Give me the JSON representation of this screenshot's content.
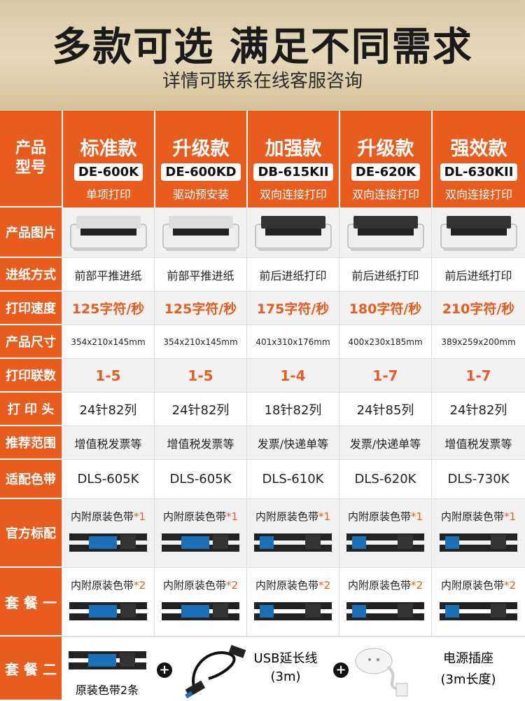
{
  "hero": {
    "title": "多款可选 满足不同需求",
    "subtitle": "详情可联系在线客服咨询"
  },
  "labels": {
    "model": "产品\n型号",
    "image": "产品图片",
    "feed": "进纸方式",
    "speed": "打印速度",
    "size": "产品尺寸",
    "copies": "打印联数",
    "head": "打 印 头",
    "usage": "推荐范围",
    "ribbon": "适配色带",
    "standard": "官方标配",
    "pkg1": "套 餐 一",
    "pkg2": "套 餐 二"
  },
  "products": [
    {
      "name": "标准款",
      "model": "DE-600K",
      "feature": "单项打印",
      "feed": "前部平推进纸",
      "speed": "125字符/秒",
      "size": "354x210x145mm",
      "copies": "1-5",
      "head": "24针82列",
      "usage": "增值税发票等",
      "ribbon": "DLS-605K",
      "std_note": "内附原装色带",
      "std_qty": "*1",
      "pkg1_note": "内附原装色带",
      "pkg1_qty": "*2"
    },
    {
      "name": "升级款",
      "model": "DE-600KD",
      "feature": "驱动预安装",
      "feed": "前部平推进纸",
      "speed": "125字符/秒",
      "size": "354x210x145mm",
      "copies": "1-5",
      "head": "24针82列",
      "usage": "增值税发票等",
      "ribbon": "DLS-605K",
      "std_note": "内附原装色带",
      "std_qty": "*1",
      "pkg1_note": "内附原装色带",
      "pkg1_qty": "*2"
    },
    {
      "name": "加强款",
      "model": "DB-615KII",
      "feature": "双向连接打印",
      "feed": "前后进纸打印",
      "speed": "175字符/秒",
      "size": "401x310x176mm",
      "copies": "1-4",
      "head": "18针82列",
      "usage": "发票/快递单等",
      "ribbon": "DLS-610K",
      "std_note": "内附原装色带",
      "std_qty": "*1",
      "pkg1_note": "内附原装色带",
      "pkg1_qty": "*2"
    },
    {
      "name": "升级款",
      "model": "DE-620K",
      "feature": "双向连接打印",
      "feed": "前后进纸打印",
      "speed": "180字符/秒",
      "size": "400x230x185mm",
      "copies": "1-7",
      "head": "24针85列",
      "usage": "发票/快递单等",
      "ribbon": "DLS-620K",
      "std_note": "内附原装色带",
      "std_qty": "*1",
      "pkg1_note": "内附原装色带",
      "pkg1_qty": "*2"
    },
    {
      "name": "强效款",
      "model": "DL-630KII",
      "feature": "双向连接打印",
      "feed": "前后进纸打印",
      "speed": "210字符/秒",
      "size": "389x259x200mm",
      "copies": "1-7",
      "head": "24针82列",
      "usage": "增值税发票等",
      "ribbon": "DLS-730K",
      "std_note": "内附原装色带",
      "std_qty": "*1",
      "pkg1_note": "内附原装色带",
      "pkg1_qty": "*2"
    }
  ],
  "pkg2": {
    "ribbon_label": "原装色带2条",
    "plus": "+",
    "usb_label": "USB延长线",
    "usb_len": "(3m)",
    "power_label": "电源插座",
    "power_len": "(3m长度)"
  },
  "colors": {
    "accent": "#e85c1e",
    "hero_bg": "#d8c9a6"
  }
}
